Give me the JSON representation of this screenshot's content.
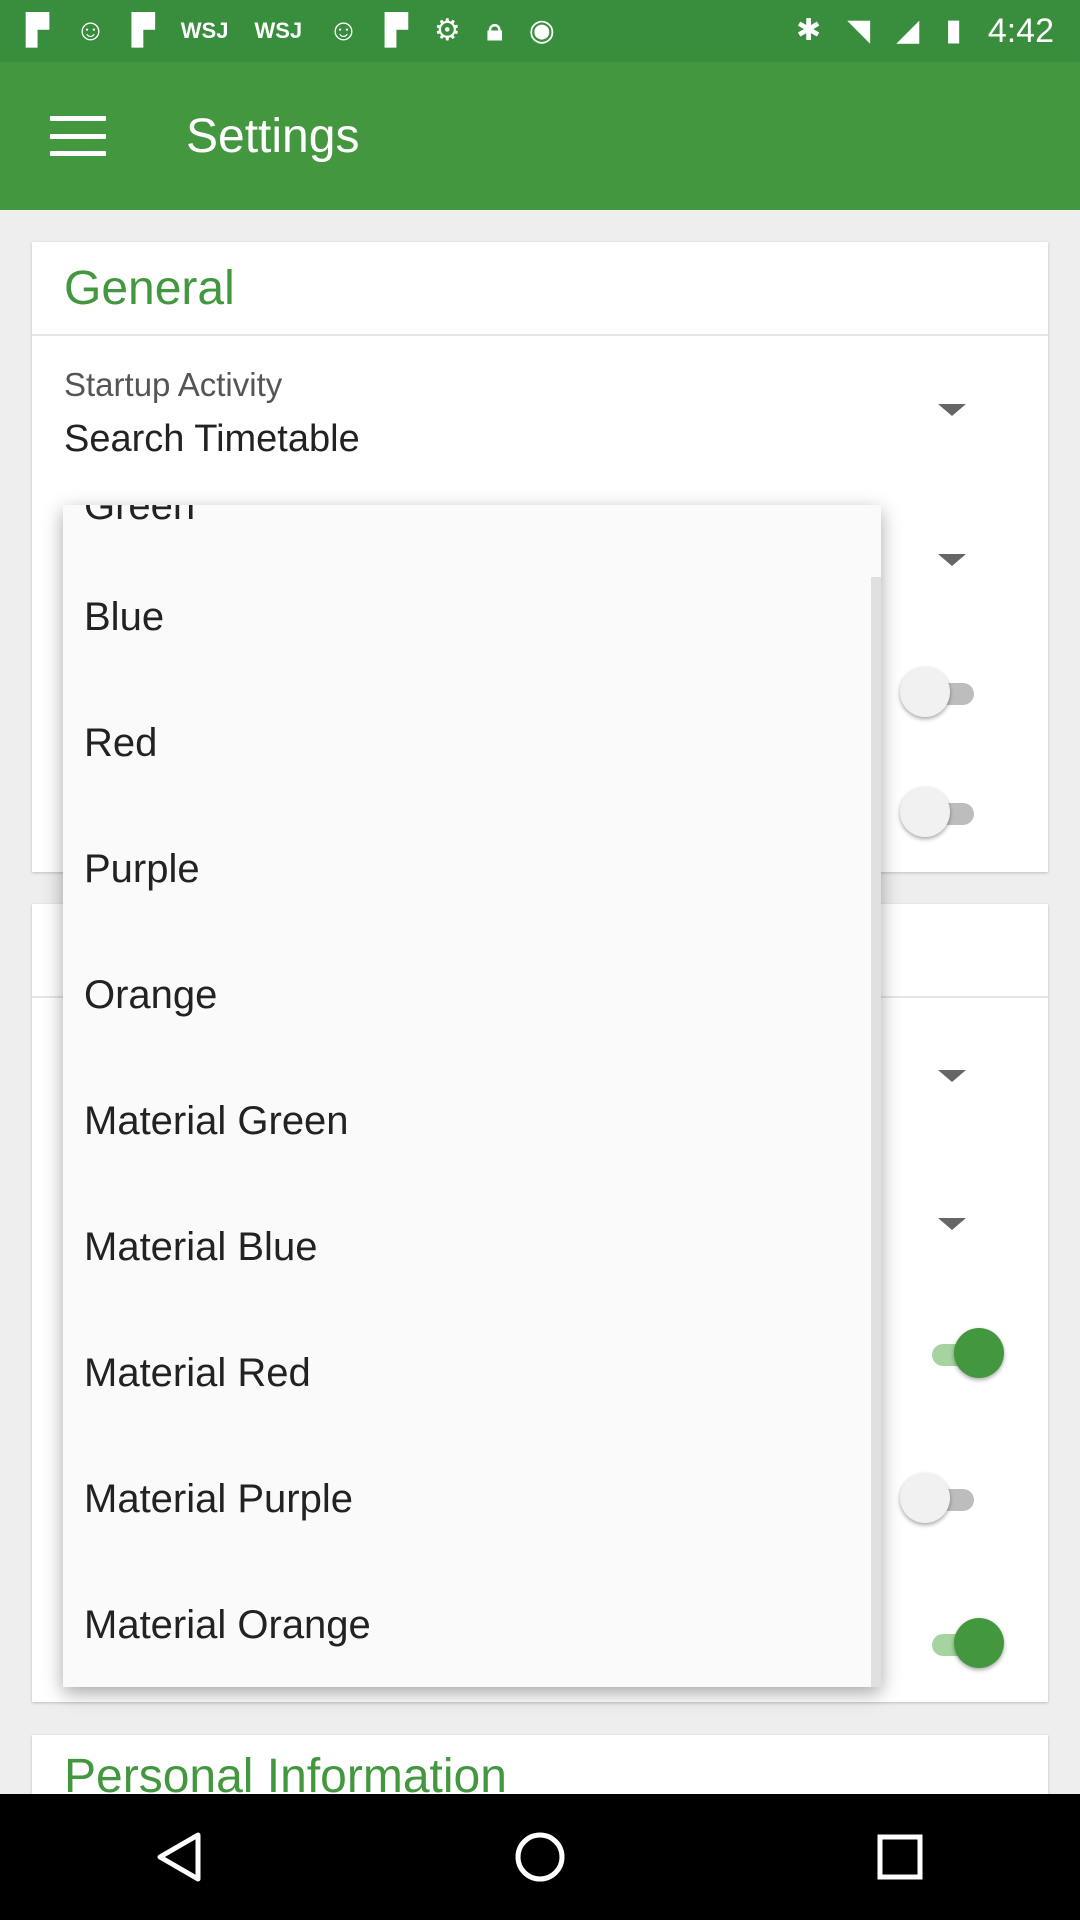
{
  "status_bar": {
    "time": "4:42",
    "left_icons": [
      "flipboard-icon",
      "smile-icon",
      "flipboard-icon",
      "wsj-icon",
      "wsj-icon",
      "smile-icon",
      "flipboard-icon",
      "settings-icon",
      "lock-icon",
      "android-icon"
    ],
    "wsj_label": "WSJ"
  },
  "app_bar": {
    "title": "Settings"
  },
  "general_card": {
    "header": "General",
    "startup": {
      "label": "Startup Activity",
      "value": "Search Timetable"
    }
  },
  "personal_card": {
    "header": "Personal Information"
  },
  "popup": {
    "partial_item": "Green",
    "items": [
      "Blue",
      "Red",
      "Purple",
      "Orange",
      "Material Green",
      "Material Blue",
      "Material Red",
      "Material Purple",
      "Material Orange"
    ]
  },
  "switches": [
    false,
    false,
    true,
    false,
    true
  ],
  "colors": {
    "primary": "#43973f",
    "primary_dark": "#388e3c"
  }
}
